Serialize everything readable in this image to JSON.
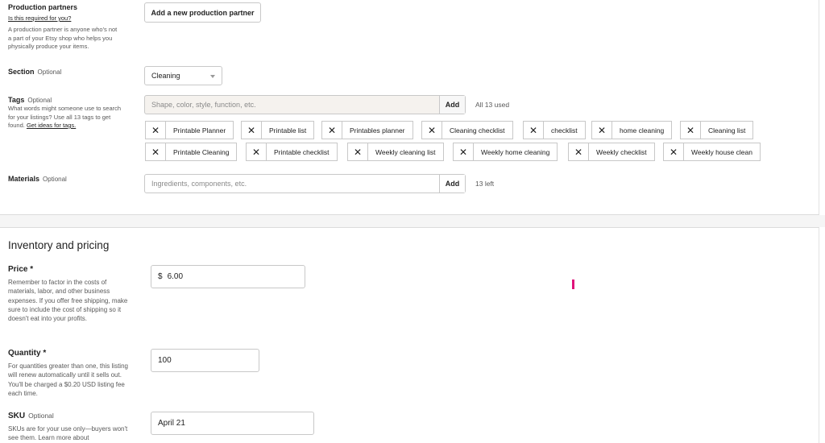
{
  "production_partners": {
    "title": "Production partners",
    "link": "Is this required for you?",
    "help": "A production partner is anyone who's not a part of your Etsy shop who helps you physically produce your items.",
    "button": "Add a new production partner"
  },
  "section": {
    "title": "Section",
    "optional": "Optional",
    "selected": "Cleaning"
  },
  "tags": {
    "title": "Tags",
    "optional": "Optional",
    "help": "What words might someone use to search for your listings? Use all 13 tags to get found.",
    "help_link": "Get ideas for tags.",
    "placeholder": "Shape, color, style, function, etc.",
    "add_label": "Add",
    "status": "All 13 used",
    "items": [
      "Printable Planner",
      "Printable list",
      "Printables planner",
      "Cleaning checklist",
      "checklist",
      "home cleaning",
      "Cleaning list",
      "Printable Cleaning",
      "Printable checklist",
      "Weekly cleaning list",
      "Weekly home cleaning",
      "Weekly checklist",
      "Weekly house clean"
    ]
  },
  "materials": {
    "title": "Materials",
    "optional": "Optional",
    "placeholder": "Ingredients, components, etc.",
    "add_label": "Add",
    "status": "13 left"
  },
  "inventory": {
    "title": "Inventory and pricing",
    "price": {
      "label": "Price *",
      "help": "Remember to factor in the costs of materials, labor, and other business expenses. If you offer free shipping, make sure to include the cost of shipping so it doesn't eat into your profits.",
      "currency": "$",
      "value": "6.00"
    },
    "quantity": {
      "label": "Quantity *",
      "help": "For quantities greater than one, this listing will renew automatically until it sells out. You'll be charged a $0.20 USD listing fee each time.",
      "value": "100"
    },
    "sku": {
      "label": "SKU",
      "optional": "Optional",
      "help": "SKUs are for your use only—buyers won't see them. Learn more about",
      "value": "April 21"
    }
  },
  "colors": {
    "cursor": "#e0137a",
    "border": "#c8c8c8"
  }
}
